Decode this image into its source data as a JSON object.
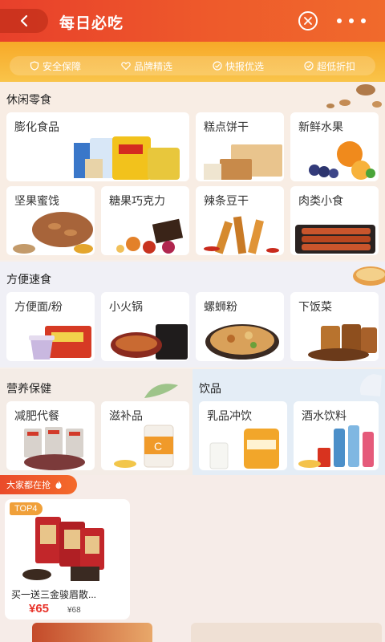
{
  "header": {
    "title": "每日必吃",
    "back_icon": "back-chevron-icon",
    "close_icon": "close-circle-icon",
    "more_icon": "more-dots-icon"
  },
  "guarantees": [
    {
      "label": "安全保障",
      "icon": "shield-icon"
    },
    {
      "label": "品牌精选",
      "icon": "heart-icon"
    },
    {
      "label": "快报优选",
      "icon": "check-circle-icon"
    },
    {
      "label": "超低折扣",
      "icon": "check-circle-icon"
    }
  ],
  "sections": {
    "snacks": {
      "title": "休闲零食",
      "items": [
        "膨化食品",
        "糕点饼干",
        "新鲜水果",
        "坚果蜜饯",
        "糖果巧克力",
        "辣条豆干",
        "肉类小食"
      ]
    },
    "instant": {
      "title": "方便速食",
      "items": [
        "方便面/粉",
        "小火锅",
        "螺蛳粉",
        "下饭菜"
      ]
    },
    "health": {
      "title": "营养保健",
      "items": [
        "减肥代餐",
        "滋补品"
      ]
    },
    "drinks": {
      "title": "饮品",
      "items": [
        "乳品冲饮",
        "酒水饮料"
      ]
    }
  },
  "hot": {
    "badge": "大家都在抢",
    "product": {
      "tag": "TOP4",
      "name": "买一送三金骏眉散...",
      "price": "¥65",
      "original_price": "¥68"
    }
  },
  "colors": {
    "header": "#e8402b",
    "accent_yellow": "#f7a928",
    "price_red": "#e8342b"
  }
}
